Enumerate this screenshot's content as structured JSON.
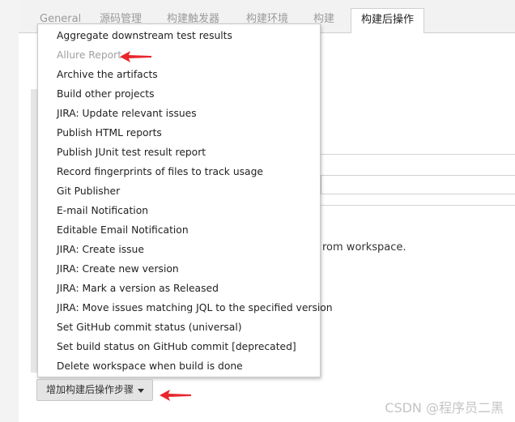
{
  "tabs": [
    {
      "label": "General"
    },
    {
      "label": "源码管理"
    },
    {
      "label": "构建触发器"
    },
    {
      "label": "构建环境"
    },
    {
      "label": "构建"
    },
    {
      "label": "构建后操作",
      "active": true
    }
  ],
  "underlying": {
    "partial_text": "rom workspace."
  },
  "menu": {
    "items": [
      {
        "label": "Aggregate downstream test results"
      },
      {
        "label": "Allure Report",
        "disabled": true
      },
      {
        "label": "Archive the artifacts"
      },
      {
        "label": "Build other projects"
      },
      {
        "label": "JIRA: Update relevant issues"
      },
      {
        "label": "Publish HTML reports"
      },
      {
        "label": "Publish JUnit test result report"
      },
      {
        "label": "Record fingerprints of files to track usage"
      },
      {
        "label": "Git Publisher"
      },
      {
        "label": "E-mail Notification"
      },
      {
        "label": "Editable Email Notification"
      },
      {
        "label": "JIRA: Create issue"
      },
      {
        "label": "JIRA: Create new version"
      },
      {
        "label": "JIRA: Mark a version as Released"
      },
      {
        "label": "JIRA: Move issues matching JQL to the specified version"
      },
      {
        "label": "Set GitHub commit status (universal)"
      },
      {
        "label": "Set build status on GitHub commit [deprecated]"
      },
      {
        "label": "Delete workspace when build is done"
      }
    ]
  },
  "add_step_button": {
    "label": "增加构建后操作步骤"
  },
  "watermark": "CSDN @程序员二黑",
  "colors": {
    "annotation_arrow": "#e8262b"
  }
}
